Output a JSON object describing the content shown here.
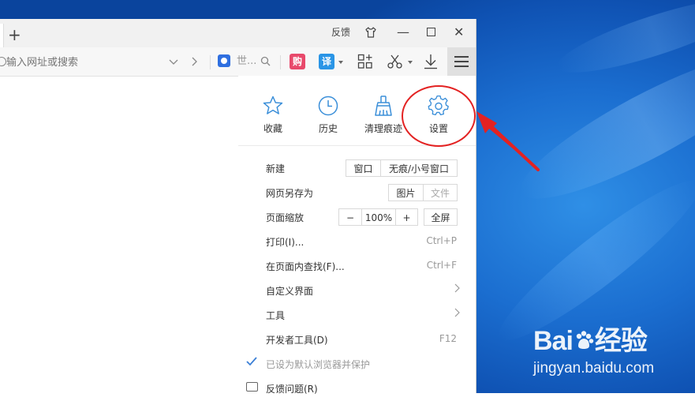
{
  "window": {
    "feedback": "反馈",
    "controls": {
      "skin": "shirt-icon",
      "minimize": "—",
      "maximize": "maximize-icon",
      "close": "✕"
    },
    "new_tab": "+"
  },
  "address_bar": {
    "placeholder": "输入网址或搜索",
    "search_engine_text": "世...",
    "gou_label": "购",
    "yi_label": "译"
  },
  "quick_actions": [
    {
      "label": "收藏",
      "icon": "star-icon"
    },
    {
      "label": "历史",
      "icon": "clock-icon"
    },
    {
      "label": "清理痕迹",
      "icon": "broom-icon"
    },
    {
      "label": "设置",
      "icon": "gear-icon"
    }
  ],
  "menu": {
    "new": {
      "label": "新建",
      "options": [
        "窗口",
        "无痕/小号窗口"
      ]
    },
    "save_as": {
      "label": "网页另存为",
      "options": [
        "图片",
        "文件"
      ]
    },
    "zoom": {
      "label": "页面缩放",
      "minus": "−",
      "value": "100%",
      "plus": "+",
      "fullscreen": "全屏"
    },
    "print": {
      "label": "打印(I)...",
      "shortcut": "Ctrl+P"
    },
    "find": {
      "label": "在页面内查找(F)...",
      "shortcut": "Ctrl+F"
    },
    "customize": {
      "label": "自定义界面"
    },
    "tools": {
      "label": "工具"
    },
    "devtools": {
      "label": "开发者工具(D)",
      "shortcut": "F12"
    },
    "default_browser": {
      "label": "已设为默认浏览器并保护"
    },
    "report": {
      "label": "反馈问题(R)"
    }
  },
  "watermark": {
    "brand": "Baidu经验",
    "brand_left": "Bai",
    "brand_right": "经验",
    "url": "jingyan.baidu.com"
  },
  "colors": {
    "highlight": "#e32222",
    "accent": "#3b8fd9",
    "desktop": "#1b6ed0"
  }
}
